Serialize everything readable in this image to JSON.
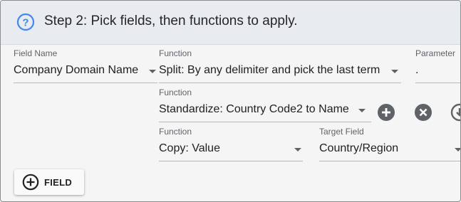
{
  "header": {
    "title": "Step 2: Pick fields, then functions to apply.",
    "icon": "help-circle-icon",
    "accent": "#4285f4"
  },
  "columns": {
    "field_name": "Field Name",
    "function": "Function",
    "parameter": "Parameter"
  },
  "row1": {
    "field": "Company Domain Name",
    "function": "Split: By any delimiter and pick the last term",
    "parameter": "."
  },
  "row2": {
    "function_label": "Function",
    "function": "Standardize: Country Code2 to Name"
  },
  "row3": {
    "function_label": "Function",
    "function": "Copy: Value",
    "target_label": "Target Field",
    "target": "Country/Region"
  },
  "add_field": {
    "label": "FIELD"
  },
  "colors": {
    "icon_gray": "#5f6368",
    "header_bg": "#e8ecf0"
  }
}
